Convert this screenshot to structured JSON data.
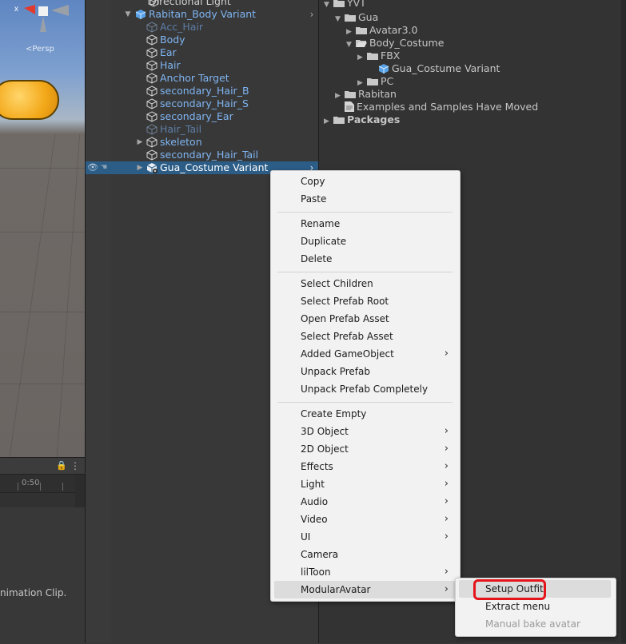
{
  "scene": {
    "axis_label": "x",
    "persp_label": "<Persp"
  },
  "animation": {
    "time_label": "0:50",
    "message": "nimation Clip."
  },
  "hierarchy": {
    "rows": [
      {
        "label": "Directional Light",
        "style": "white"
      },
      {
        "label": "Rabitan_Body Variant",
        "style": "blue"
      },
      {
        "label": "Acc_Hair",
        "style": "dim"
      },
      {
        "label": "Body",
        "style": "blue"
      },
      {
        "label": "Ear",
        "style": "blue"
      },
      {
        "label": "Hair",
        "style": "blue"
      },
      {
        "label": "Anchor Target",
        "style": "blue"
      },
      {
        "label": "secondary_Hair_B",
        "style": "blue"
      },
      {
        "label": "secondary_Hair_S",
        "style": "blue"
      },
      {
        "label": "secondary_Ear",
        "style": "blue"
      },
      {
        "label": "Hair_Tail",
        "style": "dim"
      },
      {
        "label": "skeleton",
        "style": "blue"
      },
      {
        "label": "secondary_Hair_Tail",
        "style": "blue"
      },
      {
        "label": "Gua_Costume Variant",
        "style": "white"
      }
    ]
  },
  "project": {
    "rows": [
      {
        "label": "YVT"
      },
      {
        "label": "Gua"
      },
      {
        "label": "Avatar3.0"
      },
      {
        "label": "Body_Costume"
      },
      {
        "label": "FBX"
      },
      {
        "label": "Gua_Costume Variant"
      },
      {
        "label": "PC"
      },
      {
        "label": "Rabitan"
      },
      {
        "label": "Examples and Samples Have Moved"
      },
      {
        "label": "Packages"
      }
    ]
  },
  "context_menu": {
    "items": [
      {
        "label": "Copy"
      },
      {
        "label": "Paste"
      },
      {
        "label": "Rename"
      },
      {
        "label": "Duplicate"
      },
      {
        "label": "Delete"
      },
      {
        "label": "Select Children"
      },
      {
        "label": "Select Prefab Root"
      },
      {
        "label": "Open Prefab Asset"
      },
      {
        "label": "Select Prefab Asset"
      },
      {
        "label": "Added GameObject",
        "submenu": true
      },
      {
        "label": "Unpack Prefab"
      },
      {
        "label": "Unpack Prefab Completely"
      },
      {
        "label": "Create Empty"
      },
      {
        "label": "3D Object",
        "submenu": true
      },
      {
        "label": "2D Object",
        "submenu": true
      },
      {
        "label": "Effects",
        "submenu": true
      },
      {
        "label": "Light",
        "submenu": true
      },
      {
        "label": "Audio",
        "submenu": true
      },
      {
        "label": "Video",
        "submenu": true
      },
      {
        "label": "UI",
        "submenu": true
      },
      {
        "label": "Camera"
      },
      {
        "label": "lilToon",
        "submenu": true
      },
      {
        "label": "ModularAvatar",
        "submenu": true
      }
    ],
    "submenu_glyph": "›"
  },
  "submenu": {
    "items": [
      {
        "label": "Setup Outfit"
      },
      {
        "label": "Extract menu"
      },
      {
        "label": "Manual bake avatar",
        "disabled": true
      }
    ]
  },
  "colors": {
    "selection": "#2c5d87",
    "highlight": "#e5141b",
    "prefab_blue": "#7fb5f2"
  }
}
